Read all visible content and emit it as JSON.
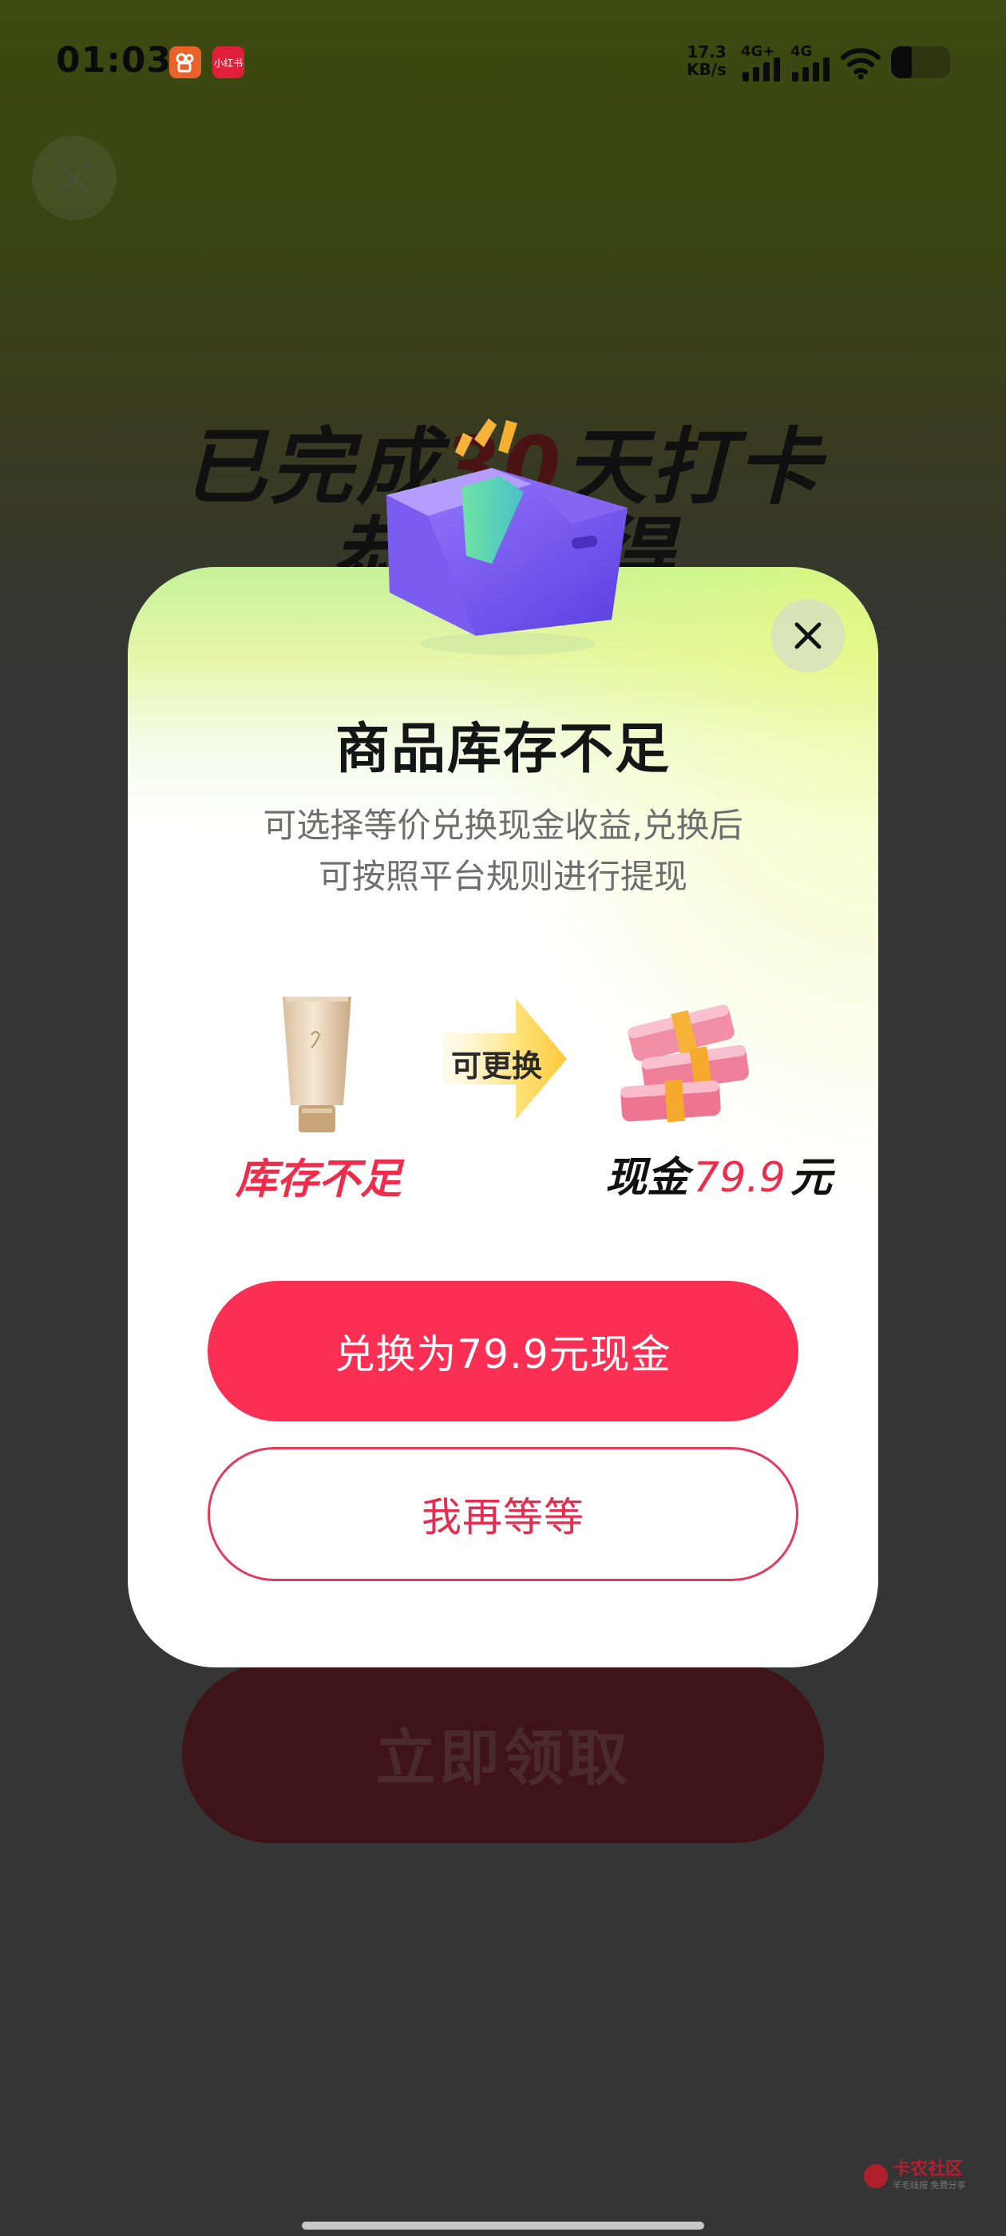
{
  "status_bar": {
    "time": "01:03",
    "app_badges": [
      "快手",
      "小红书"
    ],
    "net_speed_value": "17.3",
    "net_speed_unit": "KB/s",
    "signal_1_label": "4G+",
    "signal_2_label": "4G"
  },
  "background": {
    "title_line1_prefix": "已完成",
    "title_line1_number": "30",
    "title_line1_suffix": "天打卡",
    "title_line2": "恭喜获得",
    "claim_button": "立即领取",
    "watermark": "卡农社区",
    "watermark_sub": "羊毛线报 免费分享"
  },
  "modal": {
    "title": "商品库存不足",
    "description_line1": "可选择等价兑换现金收益,兑换后",
    "description_line2": "可按照平台规则进行提现",
    "product_status": "库存不足",
    "swap_label": "可更换",
    "cash_prefix": "现金",
    "cash_amount": "79.9",
    "cash_unit": "元",
    "primary_button": "兑换为79.9元现金",
    "secondary_button": "我再等等"
  },
  "colors": {
    "accent": "#fb2f53",
    "out_of_stock": "#ee2c4b",
    "box_purple": "#7b5cf0"
  }
}
